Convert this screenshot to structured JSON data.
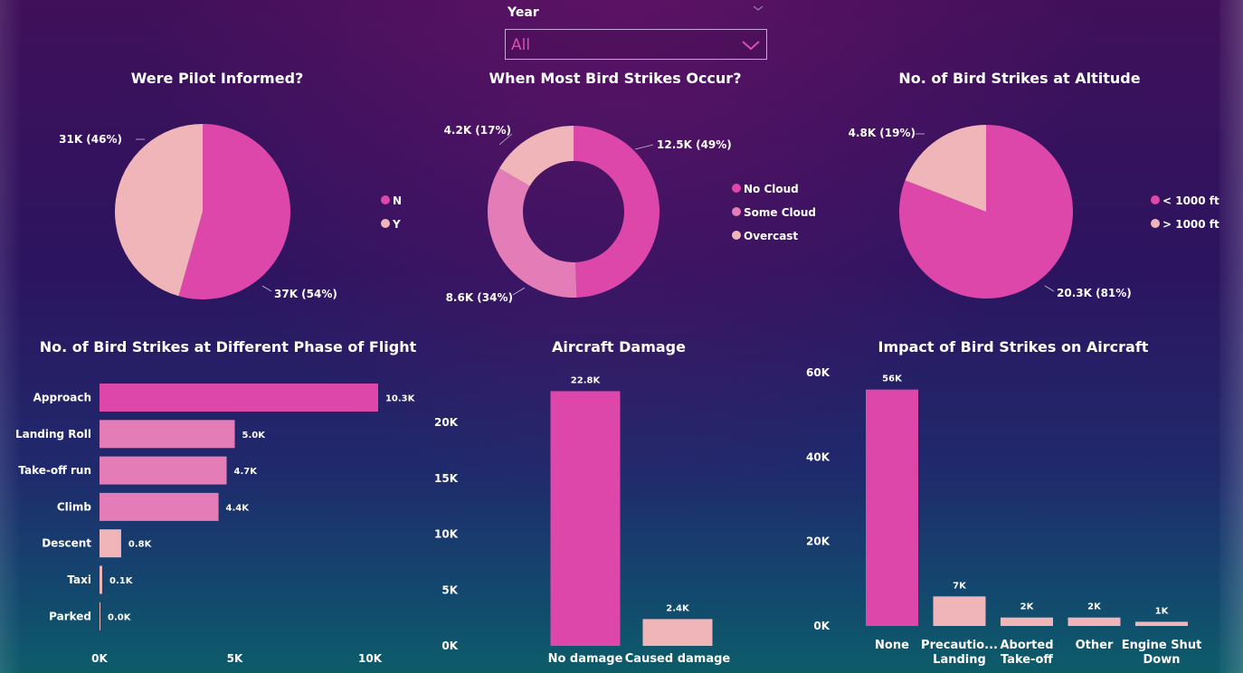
{
  "slicer": {
    "label": "Year",
    "value": "All"
  },
  "colors": {
    "pink_dark": "#de47aa",
    "pink_mid": "#e47cb8",
    "pink_light": "#efb5b8",
    "text": "#ffffff"
  },
  "chart_data": [
    {
      "type": "pie",
      "title": "Were Pilot Informed?",
      "categories": [
        "N",
        "Y"
      ],
      "values": [
        37000,
        31000
      ],
      "data_labels": [
        "37K (54%)",
        "31K (46%)"
      ],
      "legend": [
        "N",
        "Y"
      ],
      "legend_position": "right"
    },
    {
      "type": "pie",
      "subtype": "donut",
      "title": "When Most Bird Strikes Occur?",
      "categories": [
        "No Cloud",
        "Some Cloud",
        "Overcast"
      ],
      "values": [
        12500,
        8600,
        4200
      ],
      "data_labels": [
        "12.5K (49%)",
        "8.6K (34%)",
        "4.2K (17%)"
      ],
      "legend": [
        "No Cloud",
        "Some Cloud",
        "Overcast"
      ],
      "legend_position": "right"
    },
    {
      "type": "pie",
      "title": "No. of Bird Strikes at Altitude",
      "categories": [
        "< 1000 ft",
        "> 1000 ft"
      ],
      "values": [
        20300,
        4800
      ],
      "data_labels": [
        "20.3K (81%)",
        "4.8K (19%)"
      ],
      "legend": [
        "< 1000 ft",
        "> 1000 ft"
      ],
      "legend_position": "right"
    },
    {
      "type": "bar",
      "orientation": "horizontal",
      "title": "No. of Bird Strikes at Different Phase of Flight",
      "categories": [
        "Approach",
        "Landing Roll",
        "Take-off run",
        "Climb",
        "Descent",
        "Taxi",
        "Parked"
      ],
      "values": [
        10300,
        5000,
        4700,
        4400,
        800,
        100,
        0
      ],
      "data_labels": [
        "10.3K",
        "5.0K",
        "4.7K",
        "4.4K",
        "0.8K",
        "0.1K",
        "0.0K"
      ],
      "xlim": [
        0,
        10000
      ],
      "xticks": [
        "0K",
        "5K",
        "10K"
      ]
    },
    {
      "type": "bar",
      "title": "Aircraft Damage",
      "categories": [
        "No damage",
        "Caused damage"
      ],
      "values": [
        22800,
        2400
      ],
      "data_labels": [
        "22.8K",
        "2.4K"
      ],
      "ylim": [
        0,
        20000
      ],
      "yticks": [
        "0K",
        "5K",
        "10K",
        "15K",
        "20K"
      ]
    },
    {
      "type": "bar",
      "title": "Impact of Bird Strikes on Aircraft",
      "categories": [
        [
          "None"
        ],
        [
          "Precautio...",
          "Landing"
        ],
        [
          "Aborted",
          "Take-off"
        ],
        [
          "Other"
        ],
        [
          "Engine Shut",
          "Down"
        ]
      ],
      "values": [
        56000,
        7000,
        2000,
        2000,
        1000
      ],
      "data_labels": [
        "56K",
        "7K",
        "2K",
        "2K",
        "1K"
      ],
      "ylim": [
        0,
        60000
      ],
      "yticks": [
        "0K",
        "20K",
        "40K",
        "60K"
      ]
    }
  ]
}
